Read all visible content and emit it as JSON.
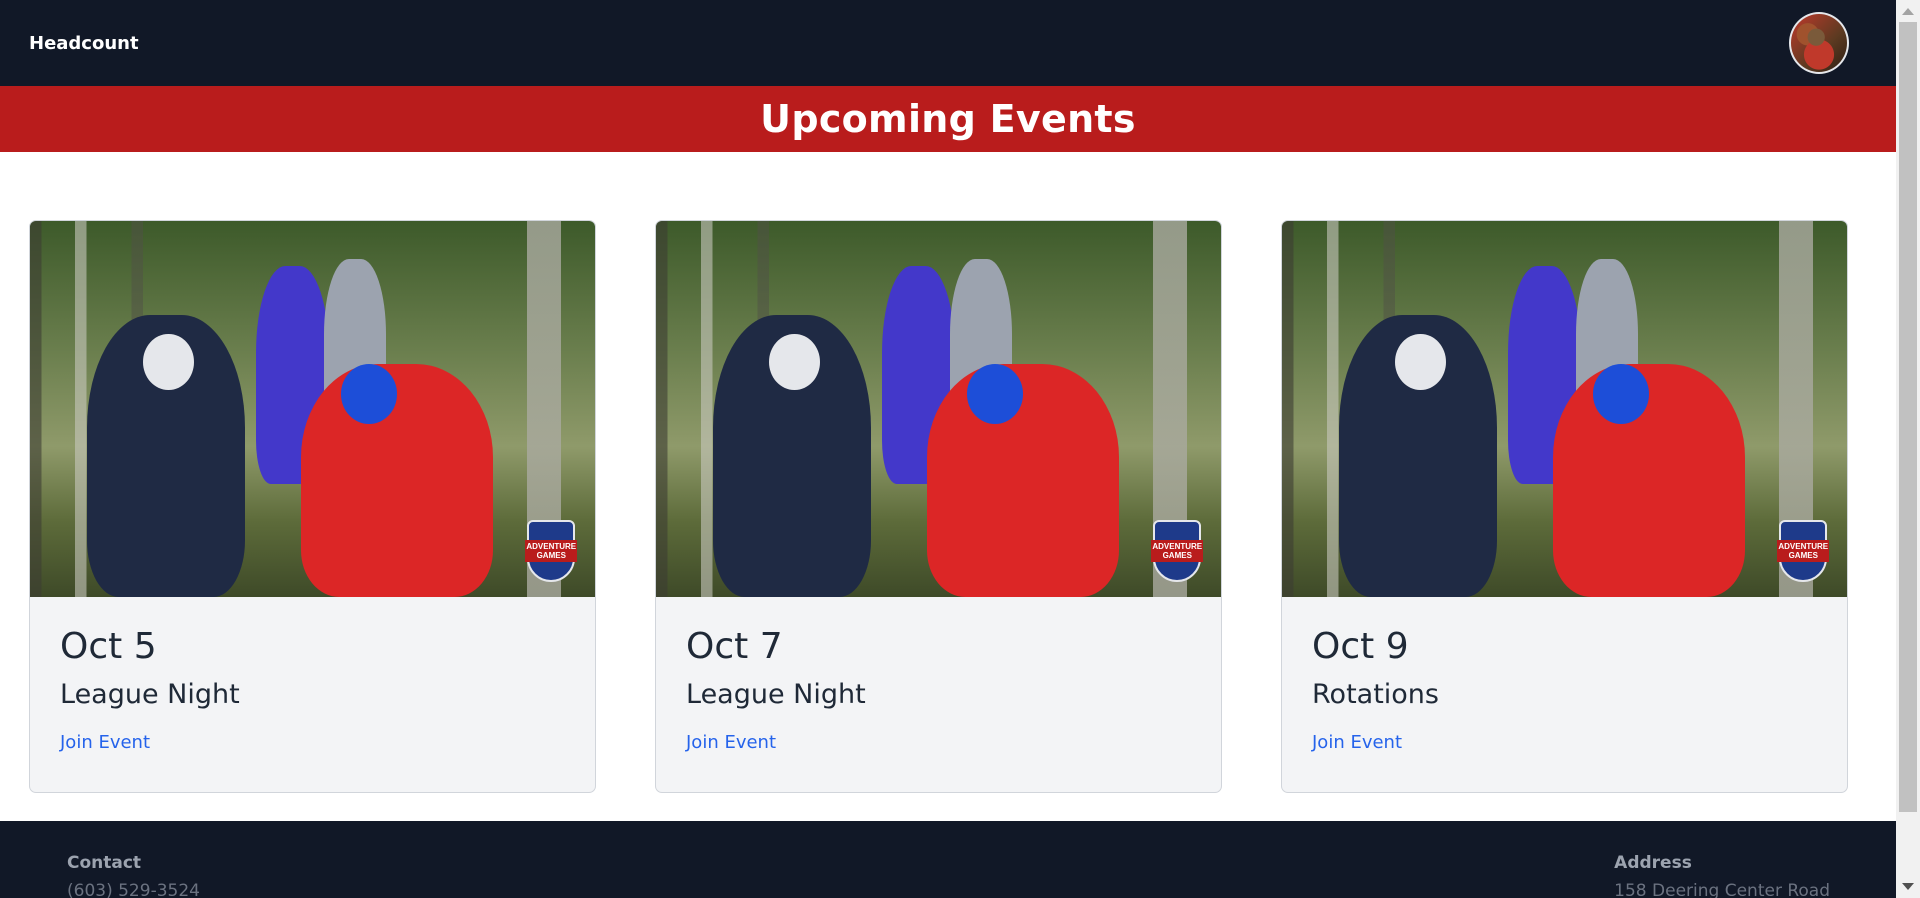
{
  "navbar": {
    "brand": "Headcount",
    "avatar_icon": "user-avatar"
  },
  "banner": {
    "title": "Upcoming Events"
  },
  "events": [
    {
      "date": "Oct 5",
      "name": "League Night",
      "link": "Join Event",
      "image_badge": "ADVENTURE GAMES"
    },
    {
      "date": "Oct 7",
      "name": "League Night",
      "link": "Join Event",
      "image_badge": "ADVENTURE GAMES"
    },
    {
      "date": "Oct 9",
      "name": "Rotations",
      "link": "Join Event",
      "image_badge": "ADVENTURE GAMES"
    }
  ],
  "footer": {
    "contact_heading": "Contact",
    "contact_phone": "(603) 529-3524",
    "address_heading": "Address",
    "address_line": "158 Deering Center Road"
  },
  "colors": {
    "navbar": "#111827",
    "banner": "#b91c1c",
    "link": "#2563eb",
    "card_bg": "#f3f4f6"
  }
}
